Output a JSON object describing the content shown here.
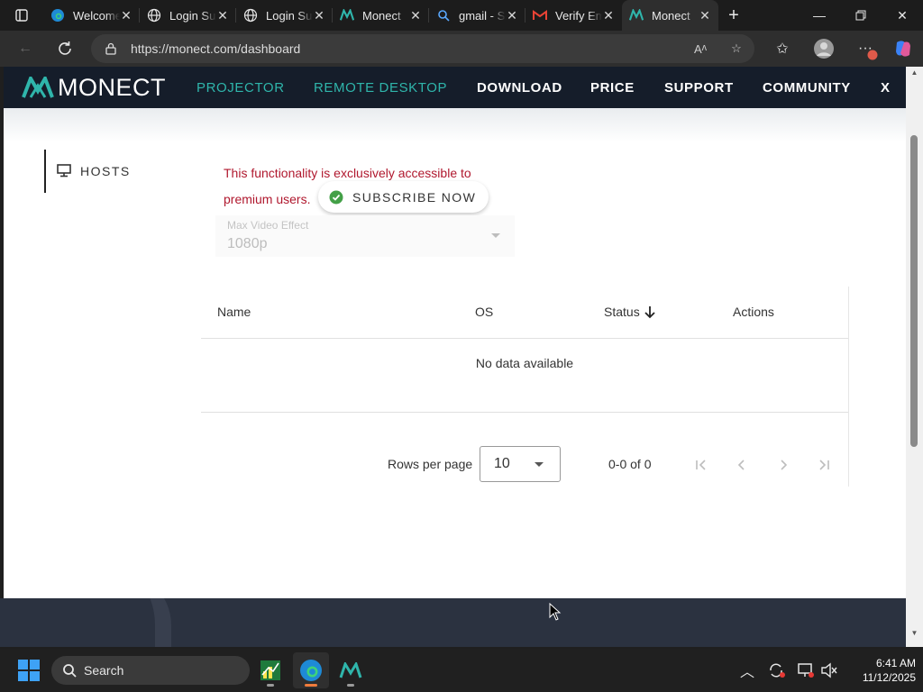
{
  "browser": {
    "tabs": [
      {
        "title": "Welcome",
        "icon": "edge-icon"
      },
      {
        "title": "Login Su",
        "icon": "globe-icon"
      },
      {
        "title": "Login Su",
        "icon": "globe-icon"
      },
      {
        "title": "Monect",
        "icon": "monect-icon"
      },
      {
        "title": "gmail - S",
        "icon": "search-icon"
      },
      {
        "title": "Verify Em",
        "icon": "gmail-icon"
      },
      {
        "title": "Monect",
        "icon": "monect-icon",
        "active": true
      }
    ],
    "url": "https://monect.com/dashboard"
  },
  "site": {
    "brand": "MONECT",
    "nav": [
      "PROJECTOR",
      "REMOTE DESKTOP",
      "DOWNLOAD",
      "PRICE",
      "SUPPORT",
      "COMMUNITY",
      "X"
    ],
    "accent_color": "#2fb5ab"
  },
  "sidebar": {
    "hosts_label": "HOSTS"
  },
  "notice": {
    "message": "This functionality is exclusively accessible to premium users.",
    "subscribe_label": "SUBSCRIBE NOW"
  },
  "video_select": {
    "label": "Max Video Effect",
    "value": "1080p"
  },
  "table": {
    "headers": {
      "name": "Name",
      "os": "OS",
      "status": "Status",
      "actions": "Actions"
    },
    "empty_text": "No data available",
    "rows_per_page_label": "Rows per page",
    "rows_per_page_value": "10",
    "range_text": "0-0 of 0"
  },
  "taskbar": {
    "search_placeholder": "Search",
    "time": "6:41 AM",
    "date": "11/12/2025"
  }
}
